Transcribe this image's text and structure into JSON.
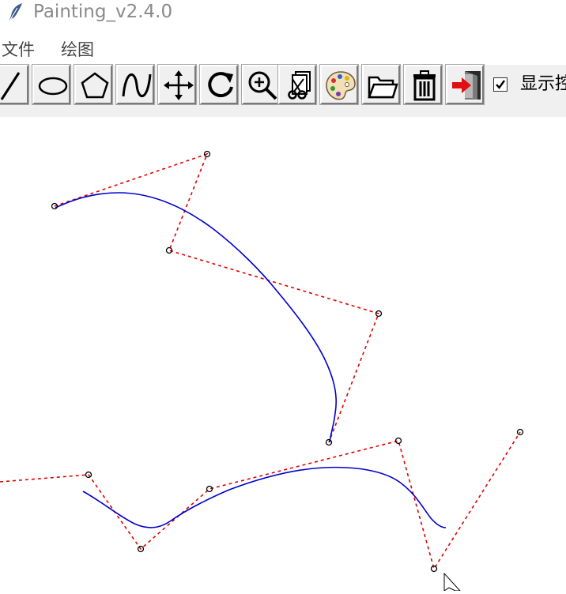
{
  "window": {
    "title": "Painting_v2.4.0"
  },
  "menu": {
    "items": [
      "文件",
      "绘图"
    ]
  },
  "toolbar": {
    "tools": [
      {
        "icon": "line-icon"
      },
      {
        "icon": "ellipse-icon"
      },
      {
        "icon": "polygon-icon"
      },
      {
        "icon": "curve-icon"
      },
      {
        "icon": "move-icon"
      },
      {
        "icon": "rotate-icon"
      },
      {
        "icon": "zoom-icon"
      },
      {
        "icon": "clip-icon"
      },
      {
        "icon": "palette-icon"
      },
      {
        "icon": "folder-icon"
      },
      {
        "icon": "trash-icon"
      },
      {
        "icon": "exit-icon"
      }
    ],
    "show_control_points": {
      "label": "显示控",
      "checked": true
    }
  },
  "canvas": {
    "curve_color": "#0000d0",
    "control_polygon_color": "#e00000",
    "control_point_color": "#000000"
  }
}
